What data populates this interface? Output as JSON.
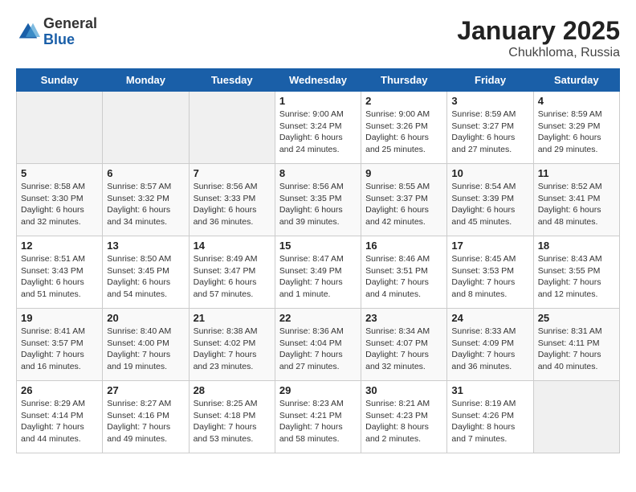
{
  "header": {
    "logo_general": "General",
    "logo_blue": "Blue",
    "month": "January 2025",
    "location": "Chukhloma, Russia"
  },
  "weekdays": [
    "Sunday",
    "Monday",
    "Tuesday",
    "Wednesday",
    "Thursday",
    "Friday",
    "Saturday"
  ],
  "weeks": [
    [
      {
        "day": "",
        "empty": true
      },
      {
        "day": "",
        "empty": true
      },
      {
        "day": "",
        "empty": true
      },
      {
        "day": "1",
        "sunrise": "Sunrise: 9:00 AM",
        "sunset": "Sunset: 3:24 PM",
        "daylight": "Daylight: 6 hours and 24 minutes."
      },
      {
        "day": "2",
        "sunrise": "Sunrise: 9:00 AM",
        "sunset": "Sunset: 3:26 PM",
        "daylight": "Daylight: 6 hours and 25 minutes."
      },
      {
        "day": "3",
        "sunrise": "Sunrise: 8:59 AM",
        "sunset": "Sunset: 3:27 PM",
        "daylight": "Daylight: 6 hours and 27 minutes."
      },
      {
        "day": "4",
        "sunrise": "Sunrise: 8:59 AM",
        "sunset": "Sunset: 3:29 PM",
        "daylight": "Daylight: 6 hours and 29 minutes."
      }
    ],
    [
      {
        "day": "5",
        "sunrise": "Sunrise: 8:58 AM",
        "sunset": "Sunset: 3:30 PM",
        "daylight": "Daylight: 6 hours and 32 minutes."
      },
      {
        "day": "6",
        "sunrise": "Sunrise: 8:57 AM",
        "sunset": "Sunset: 3:32 PM",
        "daylight": "Daylight: 6 hours and 34 minutes."
      },
      {
        "day": "7",
        "sunrise": "Sunrise: 8:56 AM",
        "sunset": "Sunset: 3:33 PM",
        "daylight": "Daylight: 6 hours and 36 minutes."
      },
      {
        "day": "8",
        "sunrise": "Sunrise: 8:56 AM",
        "sunset": "Sunset: 3:35 PM",
        "daylight": "Daylight: 6 hours and 39 minutes."
      },
      {
        "day": "9",
        "sunrise": "Sunrise: 8:55 AM",
        "sunset": "Sunset: 3:37 PM",
        "daylight": "Daylight: 6 hours and 42 minutes."
      },
      {
        "day": "10",
        "sunrise": "Sunrise: 8:54 AM",
        "sunset": "Sunset: 3:39 PM",
        "daylight": "Daylight: 6 hours and 45 minutes."
      },
      {
        "day": "11",
        "sunrise": "Sunrise: 8:52 AM",
        "sunset": "Sunset: 3:41 PM",
        "daylight": "Daylight: 6 hours and 48 minutes."
      }
    ],
    [
      {
        "day": "12",
        "sunrise": "Sunrise: 8:51 AM",
        "sunset": "Sunset: 3:43 PM",
        "daylight": "Daylight: 6 hours and 51 minutes."
      },
      {
        "day": "13",
        "sunrise": "Sunrise: 8:50 AM",
        "sunset": "Sunset: 3:45 PM",
        "daylight": "Daylight: 6 hours and 54 minutes."
      },
      {
        "day": "14",
        "sunrise": "Sunrise: 8:49 AM",
        "sunset": "Sunset: 3:47 PM",
        "daylight": "Daylight: 6 hours and 57 minutes."
      },
      {
        "day": "15",
        "sunrise": "Sunrise: 8:47 AM",
        "sunset": "Sunset: 3:49 PM",
        "daylight": "Daylight: 7 hours and 1 minute."
      },
      {
        "day": "16",
        "sunrise": "Sunrise: 8:46 AM",
        "sunset": "Sunset: 3:51 PM",
        "daylight": "Daylight: 7 hours and 4 minutes."
      },
      {
        "day": "17",
        "sunrise": "Sunrise: 8:45 AM",
        "sunset": "Sunset: 3:53 PM",
        "daylight": "Daylight: 7 hours and 8 minutes."
      },
      {
        "day": "18",
        "sunrise": "Sunrise: 8:43 AM",
        "sunset": "Sunset: 3:55 PM",
        "daylight": "Daylight: 7 hours and 12 minutes."
      }
    ],
    [
      {
        "day": "19",
        "sunrise": "Sunrise: 8:41 AM",
        "sunset": "Sunset: 3:57 PM",
        "daylight": "Daylight: 7 hours and 16 minutes."
      },
      {
        "day": "20",
        "sunrise": "Sunrise: 8:40 AM",
        "sunset": "Sunset: 4:00 PM",
        "daylight": "Daylight: 7 hours and 19 minutes."
      },
      {
        "day": "21",
        "sunrise": "Sunrise: 8:38 AM",
        "sunset": "Sunset: 4:02 PM",
        "daylight": "Daylight: 7 hours and 23 minutes."
      },
      {
        "day": "22",
        "sunrise": "Sunrise: 8:36 AM",
        "sunset": "Sunset: 4:04 PM",
        "daylight": "Daylight: 7 hours and 27 minutes."
      },
      {
        "day": "23",
        "sunrise": "Sunrise: 8:34 AM",
        "sunset": "Sunset: 4:07 PM",
        "daylight": "Daylight: 7 hours and 32 minutes."
      },
      {
        "day": "24",
        "sunrise": "Sunrise: 8:33 AM",
        "sunset": "Sunset: 4:09 PM",
        "daylight": "Daylight: 7 hours and 36 minutes."
      },
      {
        "day": "25",
        "sunrise": "Sunrise: 8:31 AM",
        "sunset": "Sunset: 4:11 PM",
        "daylight": "Daylight: 7 hours and 40 minutes."
      }
    ],
    [
      {
        "day": "26",
        "sunrise": "Sunrise: 8:29 AM",
        "sunset": "Sunset: 4:14 PM",
        "daylight": "Daylight: 7 hours and 44 minutes."
      },
      {
        "day": "27",
        "sunrise": "Sunrise: 8:27 AM",
        "sunset": "Sunset: 4:16 PM",
        "daylight": "Daylight: 7 hours and 49 minutes."
      },
      {
        "day": "28",
        "sunrise": "Sunrise: 8:25 AM",
        "sunset": "Sunset: 4:18 PM",
        "daylight": "Daylight: 7 hours and 53 minutes."
      },
      {
        "day": "29",
        "sunrise": "Sunrise: 8:23 AM",
        "sunset": "Sunset: 4:21 PM",
        "daylight": "Daylight: 7 hours and 58 minutes."
      },
      {
        "day": "30",
        "sunrise": "Sunrise: 8:21 AM",
        "sunset": "Sunset: 4:23 PM",
        "daylight": "Daylight: 8 hours and 2 minutes."
      },
      {
        "day": "31",
        "sunrise": "Sunrise: 8:19 AM",
        "sunset": "Sunset: 4:26 PM",
        "daylight": "Daylight: 8 hours and 7 minutes."
      },
      {
        "day": "",
        "empty": true
      }
    ]
  ]
}
